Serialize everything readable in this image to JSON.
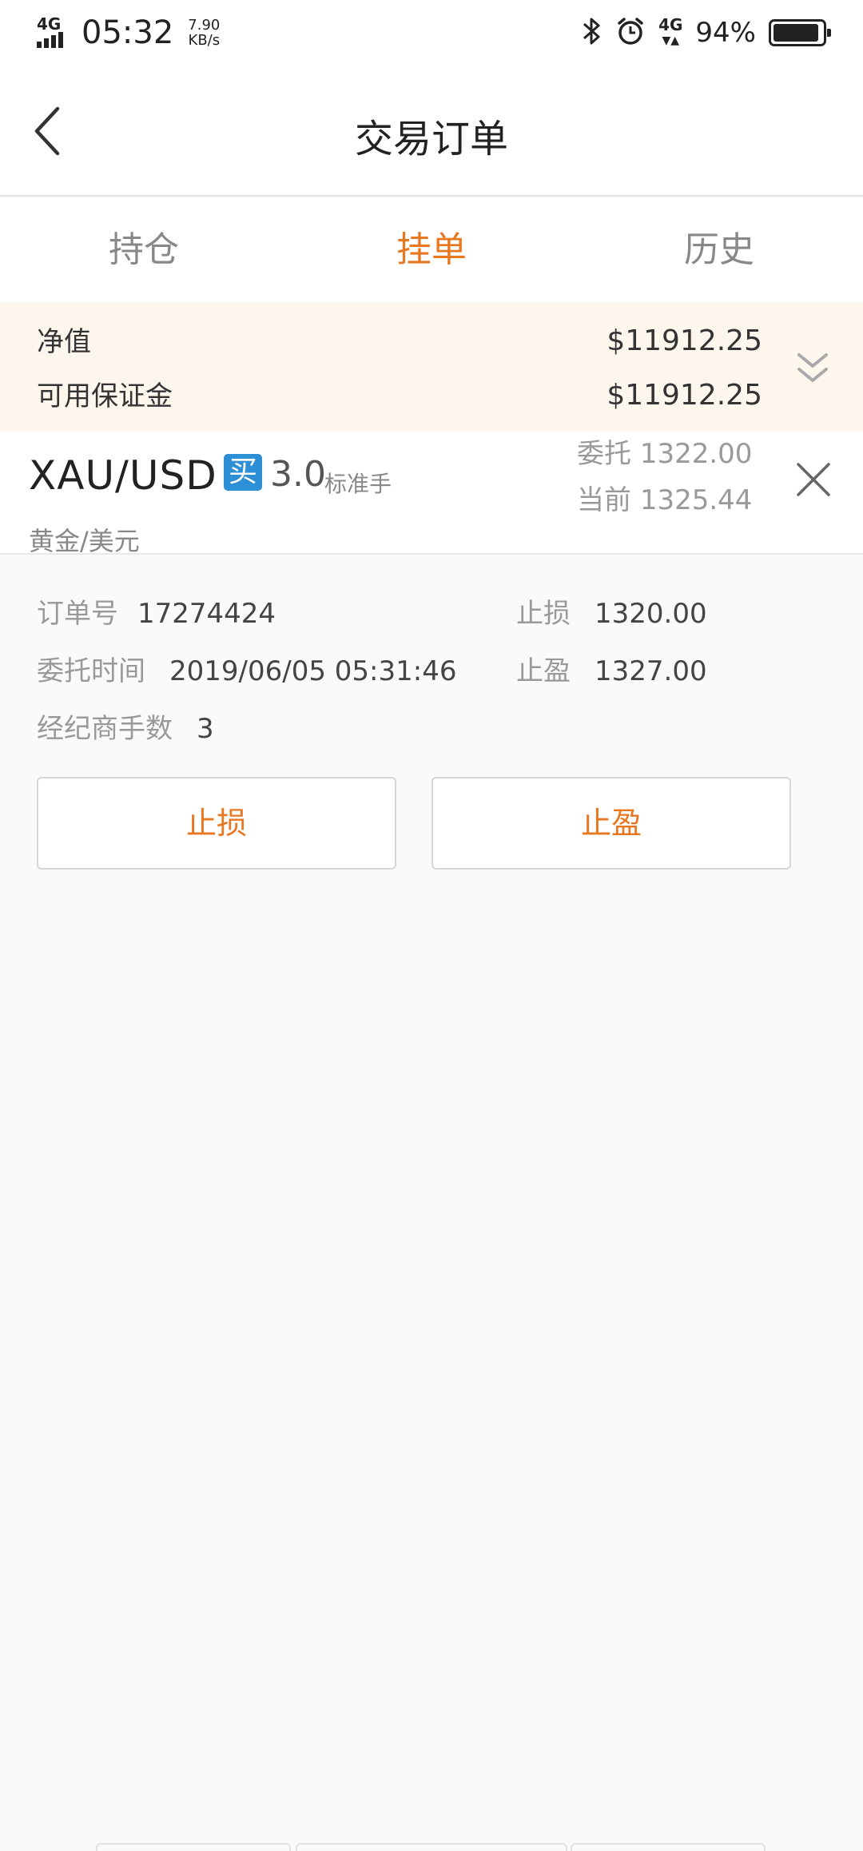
{
  "status_bar": {
    "network_left": "4G",
    "time": "05:32",
    "speed_value": "7.90",
    "speed_unit": "KB/s",
    "network_right": "4G",
    "battery_percent": "94%",
    "battery_level": 0.94,
    "icons": [
      "signal-icon",
      "bluetooth-icon",
      "alarm-icon",
      "battery-icon"
    ]
  },
  "nav": {
    "title": "交易订单",
    "back_icon": "chevron-left-icon"
  },
  "tabs": [
    {
      "label": "持仓",
      "active": false
    },
    {
      "label": "挂单",
      "active": true
    },
    {
      "label": "历史",
      "active": false
    }
  ],
  "summary": {
    "net_value_label": "净值",
    "net_value": "$11912.25",
    "available_margin_label": "可用保证金",
    "available_margin": "$11912.25",
    "expand_icon": "double-chevron-down-icon"
  },
  "order": {
    "symbol": "XAU/USD",
    "side_badge": "买",
    "lots": "3.0",
    "lots_unit": "标准手",
    "symbol_cn": "黄金/美元",
    "entrust_label": "委托",
    "entrust_price": "1322.00",
    "current_label": "当前",
    "current_price": "1325.44",
    "close_icon": "close-icon"
  },
  "details": {
    "order_no_label": "订单号",
    "order_no": "17274424",
    "stop_loss_label": "止损",
    "stop_loss": "1320.00",
    "entrust_time_label": "委托时间",
    "entrust_time": "2019/06/05 05:31:46",
    "take_profit_label": "止盈",
    "take_profit": "1327.00",
    "broker_lots_label": "经纪商手数",
    "broker_lots": "3"
  },
  "actions": {
    "stop_loss_button": "止损",
    "take_profit_button": "止盈"
  },
  "colors": {
    "accent": "#e87722",
    "buy_badge": "#2d8fd5",
    "summary_bg": "#fdf6ec"
  }
}
